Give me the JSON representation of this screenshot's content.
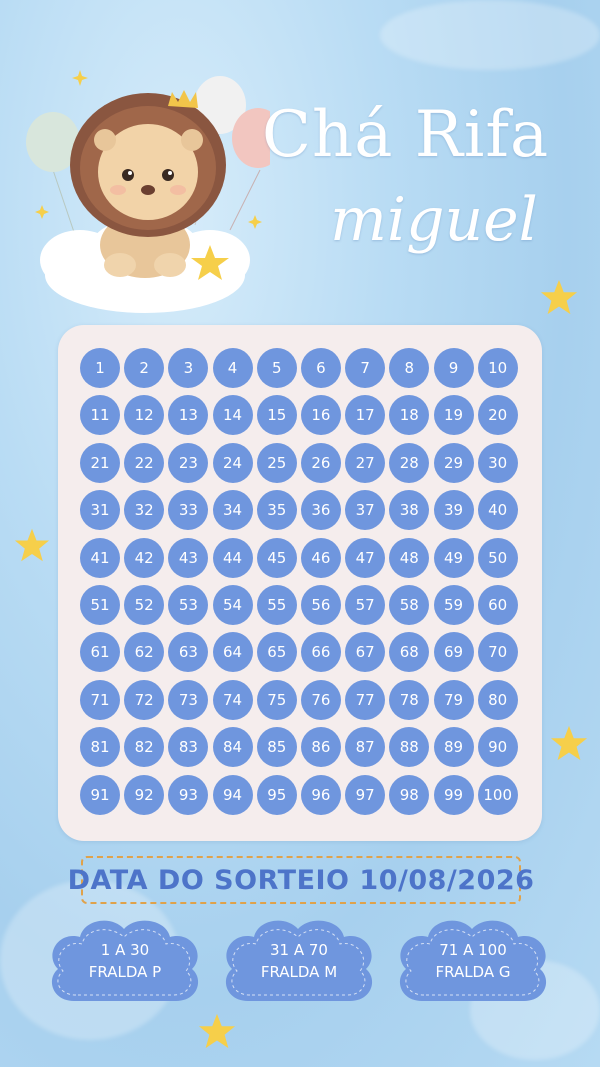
{
  "header": {
    "title": "Chá Rifa",
    "name": "miguel"
  },
  "raffle": {
    "numbers": [
      "1",
      "2",
      "3",
      "4",
      "5",
      "6",
      "7",
      "8",
      "9",
      "10",
      "11",
      "12",
      "13",
      "14",
      "15",
      "16",
      "17",
      "18",
      "19",
      "20",
      "21",
      "22",
      "23",
      "24",
      "25",
      "26",
      "27",
      "28",
      "29",
      "30",
      "31",
      "32",
      "33",
      "34",
      "35",
      "36",
      "37",
      "38",
      "39",
      "40",
      "41",
      "42",
      "43",
      "44",
      "45",
      "46",
      "47",
      "48",
      "49",
      "50",
      "51",
      "52",
      "53",
      "54",
      "55",
      "56",
      "57",
      "58",
      "59",
      "60",
      "61",
      "62",
      "63",
      "64",
      "65",
      "66",
      "67",
      "68",
      "69",
      "70",
      "71",
      "72",
      "73",
      "74",
      "75",
      "76",
      "77",
      "78",
      "79",
      "80",
      "81",
      "82",
      "83",
      "84",
      "85",
      "86",
      "87",
      "88",
      "89",
      "90",
      "91",
      "92",
      "93",
      "94",
      "95",
      "96",
      "97",
      "98",
      "99",
      "100"
    ]
  },
  "draw": {
    "date_text": "DATA DO SORTEIO 10/08/2026"
  },
  "prizes": [
    {
      "range": "1 A 30",
      "item": "FRALDA P"
    },
    {
      "range": "31 A 70",
      "item": "FRALDA M"
    },
    {
      "range": "71 A 100",
      "item": "FRALDA G"
    }
  ],
  "colors": {
    "background": "#b9dcf4",
    "card": "#f5eded",
    "number_circle": "#6f96de",
    "date_text": "#4d74c9",
    "date_border": "#e0a24a",
    "star": "#f6cf4a"
  },
  "icons": [
    "lion-illustration",
    "balloon-icon",
    "cloud-icon",
    "star-icon"
  ]
}
